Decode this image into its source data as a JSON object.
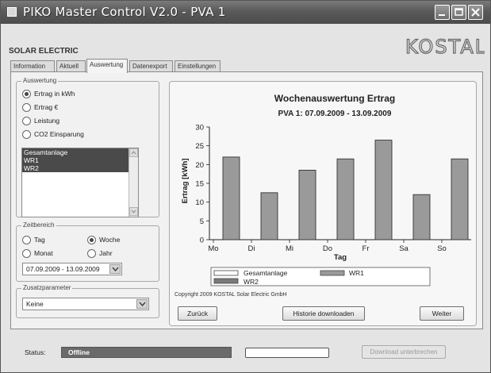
{
  "window": {
    "title": "PIKO Master Control V2.0 - PVA 1"
  },
  "header": {
    "company": "SOLAR ELECTRIC",
    "logo_text": "KOSTAL"
  },
  "tabs": [
    {
      "label": "Information"
    },
    {
      "label": "Aktuell"
    },
    {
      "label": "Auswertung",
      "active": true
    },
    {
      "label": "Datenexport"
    },
    {
      "label": "Einstellungen"
    }
  ],
  "auswertung": {
    "label": "Auswertung",
    "options": [
      {
        "label": "Ertrag in kWh",
        "checked": true
      },
      {
        "label": "Ertrag €",
        "checked": false
      },
      {
        "label": "Leistung",
        "checked": false
      },
      {
        "label": "CO2 Einsparung",
        "checked": false
      }
    ],
    "list_items": [
      "Gesamtanlage",
      "WR1",
      "WR2"
    ]
  },
  "zeitbereich": {
    "label": "Zeitbereich",
    "tag": "Tag",
    "woche": "Woche",
    "monat": "Monat",
    "jahr": "Jahr",
    "selected": "Woche",
    "date_range": "07.09.2009 - 13.09.2009"
  },
  "zusatzparameter": {
    "label": "Zusatzparameter",
    "value": "Keine"
  },
  "chart_data": {
    "type": "bar",
    "title": "Wochenauswertung Ertrag",
    "subtitle": "PVA 1: 07.09.2009 - 13.09.2009",
    "xlabel": "Tag",
    "ylabel": "Ertrag [kWh]",
    "categories": [
      "Mo",
      "Di",
      "Mi",
      "Do",
      "Fr",
      "Sa",
      "So"
    ],
    "series": [
      {
        "name": "WR1",
        "values": [
          22,
          12.5,
          18.5,
          21.5,
          26.5,
          12,
          21.5
        ]
      }
    ],
    "ylim": [
      0,
      30
    ],
    "yticks": [
      0,
      5,
      10,
      15,
      20,
      25,
      30
    ],
    "legend": [
      "Gesamtanlage",
      "WR1",
      "WR2"
    ],
    "legend_position": "bottom",
    "grid": false,
    "colors": {
      "bar": "#9a9a9a",
      "bar_border": "#333333"
    }
  },
  "copyright": "Copyright 2009 KOSTAL Solar Electric GmbH",
  "buttons": {
    "back": "Zurück",
    "history_download": "Historie downloaden",
    "next": "Weiter"
  },
  "status": {
    "label": "Status:",
    "value": "Offline",
    "progress": 0,
    "cancel_label": "Download unterbrechen"
  }
}
